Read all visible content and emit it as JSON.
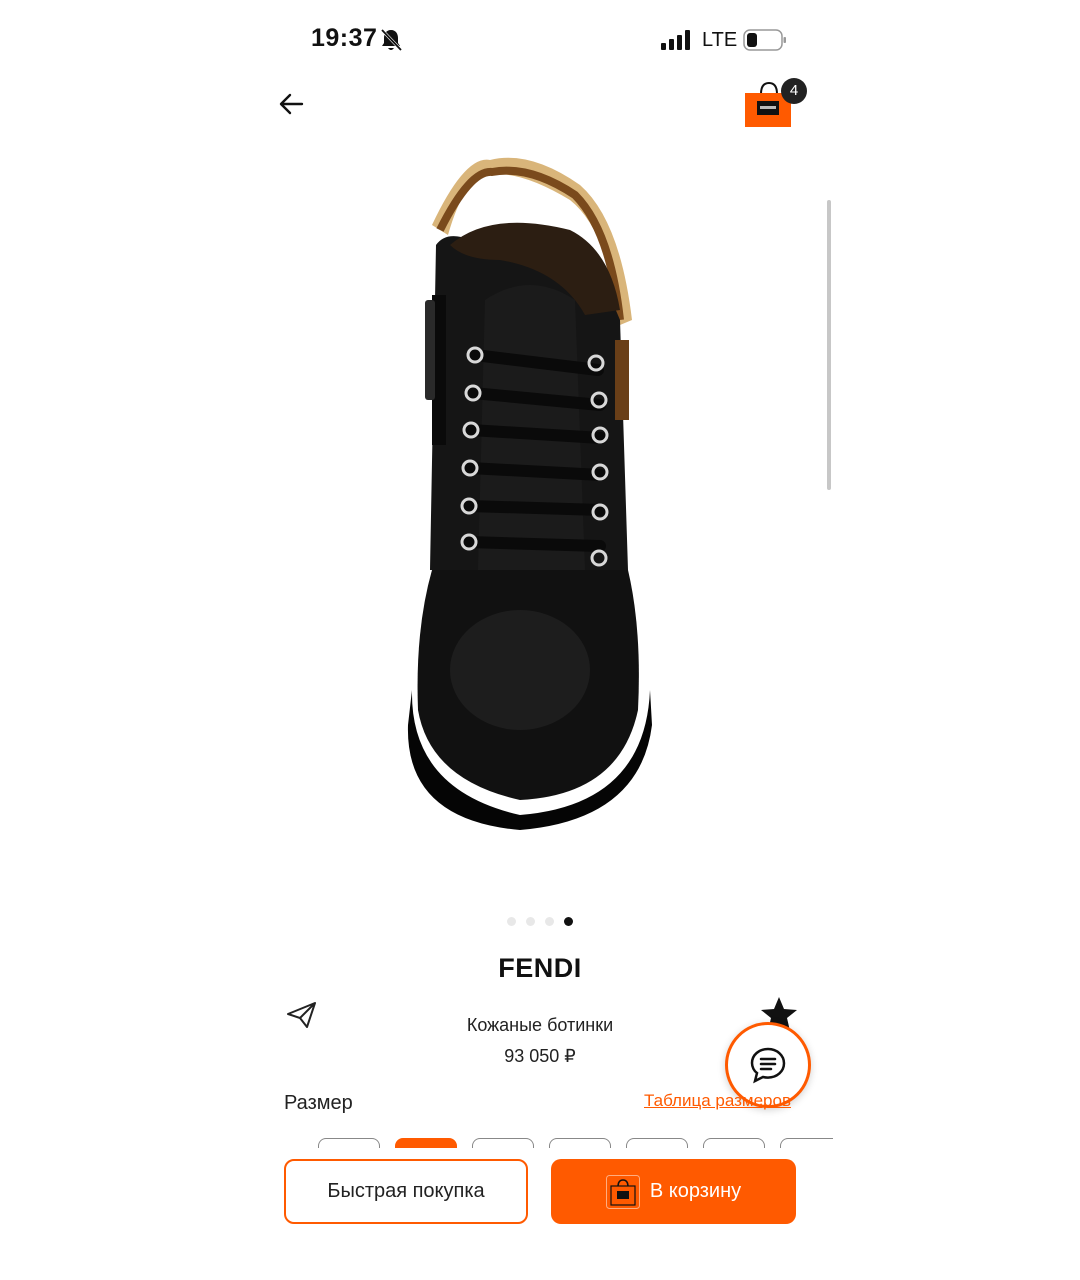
{
  "status_bar": {
    "time": "19:37",
    "network": "LTE"
  },
  "header": {
    "cart_count": "4"
  },
  "carousel": {
    "total": 4,
    "active_index": 3
  },
  "product": {
    "brand": "FENDI",
    "name": "Кожаные ботинки",
    "price": "93 050 ₽"
  },
  "size_section": {
    "label": "Размер",
    "table_link": "Таблица размеров"
  },
  "actions": {
    "quick_buy": "Быстрая покупка",
    "add_to_cart": "В корзину"
  },
  "colors": {
    "accent": "#ff5a00",
    "text": "#111111"
  },
  "icons": [
    "bell-off-icon",
    "signal-icon",
    "battery-icon",
    "back-arrow-icon",
    "cart-bag-icon",
    "share-icon",
    "favorite-star-icon",
    "chat-icon"
  ]
}
